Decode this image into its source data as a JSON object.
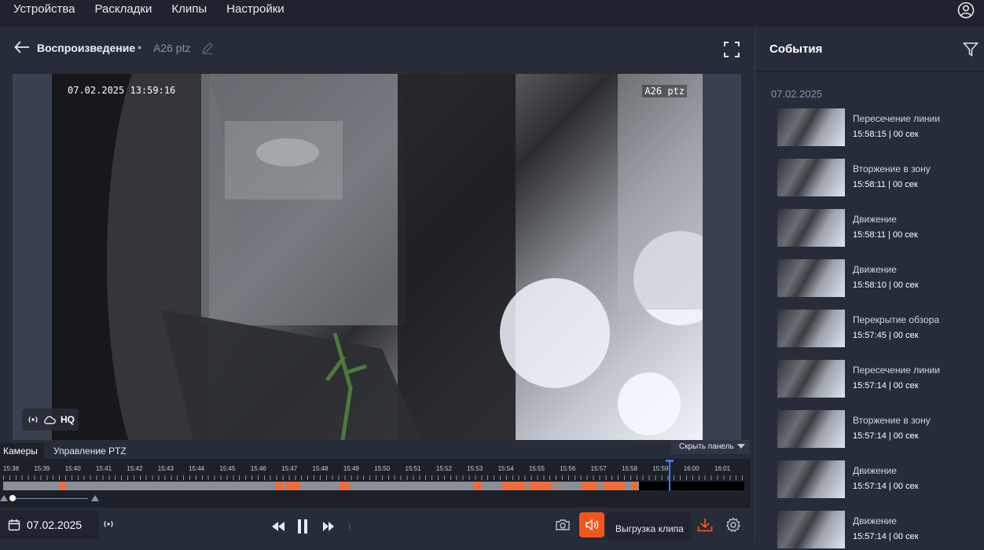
{
  "nav": {
    "items": [
      "Устройства",
      "Раскладки",
      "Клипы",
      "Настройки"
    ]
  },
  "header": {
    "title": "Воспроизведение",
    "separator": "•",
    "camera": "A26 ptz"
  },
  "video": {
    "osd_time": "07.02.2025 13:59:16",
    "osd_camera": "A26 ptz",
    "quality": "HQ"
  },
  "panel": {
    "tab_cameras": "Камеры",
    "tab_ptz": "Управление PTZ",
    "hide_panel": "Скрыть панель"
  },
  "timeline": {
    "ticks": [
      "15:38",
      "15:39",
      "15:40",
      "15:41",
      "15:42",
      "15:43",
      "15:44",
      "15:45",
      "15:46",
      "15:47",
      "15:48",
      "15:49",
      "15:50",
      "15:51",
      "15:52",
      "15:53",
      "15:54",
      "15:55",
      "15:56",
      "15:57",
      "15:58",
      "15:59",
      "16:00",
      "16:01"
    ],
    "playhead_time": "15:59"
  },
  "controls": {
    "date": "07.02.2025",
    "export_label": "Выгрузка клипа"
  },
  "events": {
    "title": "События",
    "date": "07.02.2025",
    "items": [
      {
        "type": "Пересечение линии",
        "time": "15:58:15 | 00 сек"
      },
      {
        "type": "Вторжение в зону",
        "time": "15:58:11 | 00 сек"
      },
      {
        "type": "Движение",
        "time": "15:58:11 | 00 сек"
      },
      {
        "type": "Движение",
        "time": "15:58:10 | 00 сек"
      },
      {
        "type": "Перекрытие обзора",
        "time": "15:57:45 | 00 сек"
      },
      {
        "type": "Пересечение линии",
        "time": "15:57:14 | 00 сек"
      },
      {
        "type": "Вторжение в зону",
        "time": "15:57:14 | 00 сек"
      },
      {
        "type": "Движение",
        "time": "15:57:14 | 00 сек"
      },
      {
        "type": "Движение",
        "time": "15:57:14 | 00 сек"
      }
    ]
  },
  "colors": {
    "accent": "#f2551e",
    "event_segment": "#f26a3a",
    "playhead": "#3d7bf5"
  }
}
